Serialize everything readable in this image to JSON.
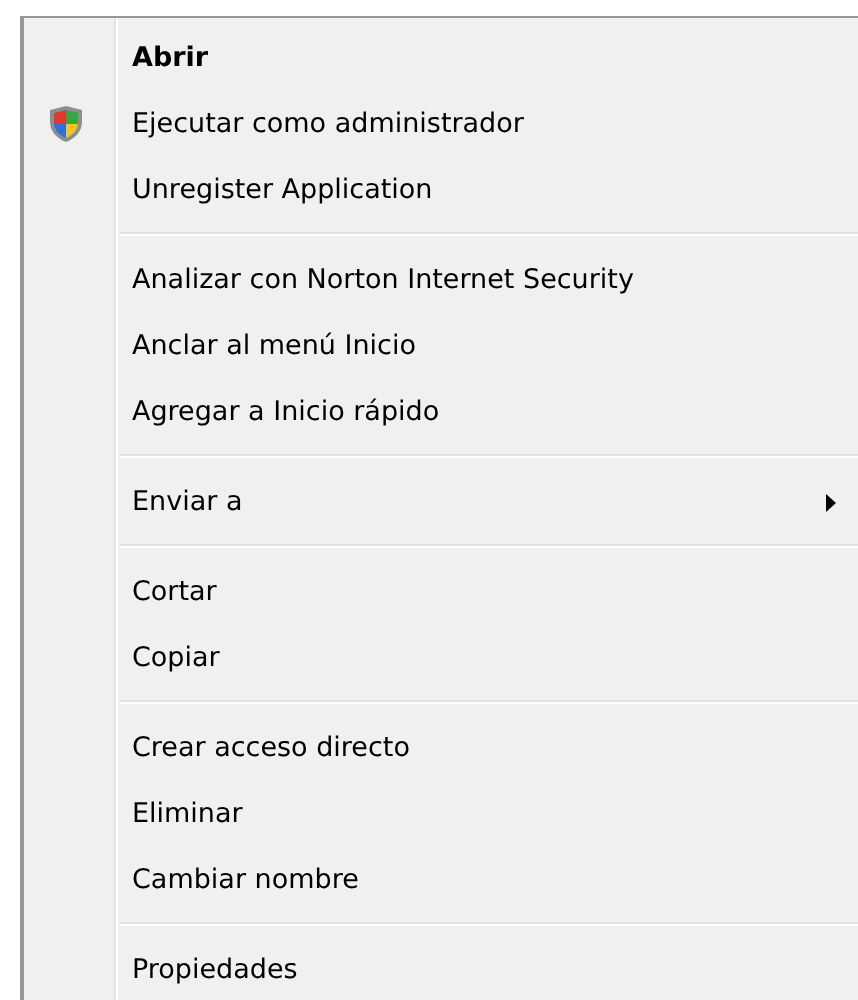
{
  "menu": [
    {
      "kind": "item",
      "label": "Abrir",
      "default": true
    },
    {
      "kind": "admin-item",
      "label": "Ejecutar como administrador"
    },
    {
      "kind": "item",
      "label": "Unregister Application"
    },
    {
      "kind": "separator"
    },
    {
      "kind": "item",
      "label": "Analizar con Norton Internet Security"
    },
    {
      "kind": "item",
      "label": "Anclar al menú Inicio"
    },
    {
      "kind": "item",
      "label": "Agregar a Inicio rápido"
    },
    {
      "kind": "separator"
    },
    {
      "kind": "item",
      "label": "Enviar a",
      "submenu": true
    },
    {
      "kind": "separator"
    },
    {
      "kind": "item",
      "label": "Cortar"
    },
    {
      "kind": "item",
      "label": "Copiar"
    },
    {
      "kind": "separator"
    },
    {
      "kind": "item",
      "label": "Crear acceso directo"
    },
    {
      "kind": "item",
      "label": "Eliminar"
    },
    {
      "kind": "item",
      "label": "Cambiar nombre"
    },
    {
      "kind": "separator"
    },
    {
      "kind": "item",
      "label": "Propiedades"
    }
  ]
}
